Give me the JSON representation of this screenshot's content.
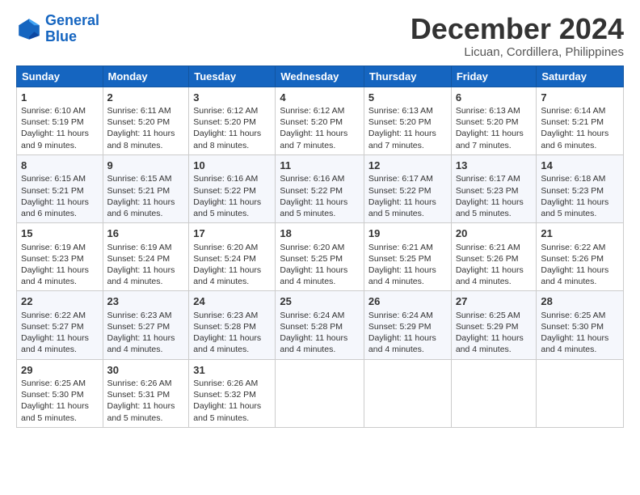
{
  "logo": {
    "line1": "General",
    "line2": "Blue"
  },
  "title": "December 2024",
  "subtitle": "Licuan, Cordillera, Philippines",
  "headers": [
    "Sunday",
    "Monday",
    "Tuesday",
    "Wednesday",
    "Thursday",
    "Friday",
    "Saturday"
  ],
  "weeks": [
    [
      {
        "day": "1",
        "sunrise": "6:10 AM",
        "sunset": "5:19 PM",
        "daylight": "11 hours and 9 minutes."
      },
      {
        "day": "2",
        "sunrise": "6:11 AM",
        "sunset": "5:20 PM",
        "daylight": "11 hours and 8 minutes."
      },
      {
        "day": "3",
        "sunrise": "6:12 AM",
        "sunset": "5:20 PM",
        "daylight": "11 hours and 8 minutes."
      },
      {
        "day": "4",
        "sunrise": "6:12 AM",
        "sunset": "5:20 PM",
        "daylight": "11 hours and 7 minutes."
      },
      {
        "day": "5",
        "sunrise": "6:13 AM",
        "sunset": "5:20 PM",
        "daylight": "11 hours and 7 minutes."
      },
      {
        "day": "6",
        "sunrise": "6:13 AM",
        "sunset": "5:20 PM",
        "daylight": "11 hours and 7 minutes."
      },
      {
        "day": "7",
        "sunrise": "6:14 AM",
        "sunset": "5:21 PM",
        "daylight": "11 hours and 6 minutes."
      }
    ],
    [
      {
        "day": "8",
        "sunrise": "6:15 AM",
        "sunset": "5:21 PM",
        "daylight": "11 hours and 6 minutes."
      },
      {
        "day": "9",
        "sunrise": "6:15 AM",
        "sunset": "5:21 PM",
        "daylight": "11 hours and 6 minutes."
      },
      {
        "day": "10",
        "sunrise": "6:16 AM",
        "sunset": "5:22 PM",
        "daylight": "11 hours and 5 minutes."
      },
      {
        "day": "11",
        "sunrise": "6:16 AM",
        "sunset": "5:22 PM",
        "daylight": "11 hours and 5 minutes."
      },
      {
        "day": "12",
        "sunrise": "6:17 AM",
        "sunset": "5:22 PM",
        "daylight": "11 hours and 5 minutes."
      },
      {
        "day": "13",
        "sunrise": "6:17 AM",
        "sunset": "5:23 PM",
        "daylight": "11 hours and 5 minutes."
      },
      {
        "day": "14",
        "sunrise": "6:18 AM",
        "sunset": "5:23 PM",
        "daylight": "11 hours and 5 minutes."
      }
    ],
    [
      {
        "day": "15",
        "sunrise": "6:19 AM",
        "sunset": "5:23 PM",
        "daylight": "11 hours and 4 minutes."
      },
      {
        "day": "16",
        "sunrise": "6:19 AM",
        "sunset": "5:24 PM",
        "daylight": "11 hours and 4 minutes."
      },
      {
        "day": "17",
        "sunrise": "6:20 AM",
        "sunset": "5:24 PM",
        "daylight": "11 hours and 4 minutes."
      },
      {
        "day": "18",
        "sunrise": "6:20 AM",
        "sunset": "5:25 PM",
        "daylight": "11 hours and 4 minutes."
      },
      {
        "day": "19",
        "sunrise": "6:21 AM",
        "sunset": "5:25 PM",
        "daylight": "11 hours and 4 minutes."
      },
      {
        "day": "20",
        "sunrise": "6:21 AM",
        "sunset": "5:26 PM",
        "daylight": "11 hours and 4 minutes."
      },
      {
        "day": "21",
        "sunrise": "6:22 AM",
        "sunset": "5:26 PM",
        "daylight": "11 hours and 4 minutes."
      }
    ],
    [
      {
        "day": "22",
        "sunrise": "6:22 AM",
        "sunset": "5:27 PM",
        "daylight": "11 hours and 4 minutes."
      },
      {
        "day": "23",
        "sunrise": "6:23 AM",
        "sunset": "5:27 PM",
        "daylight": "11 hours and 4 minutes."
      },
      {
        "day": "24",
        "sunrise": "6:23 AM",
        "sunset": "5:28 PM",
        "daylight": "11 hours and 4 minutes."
      },
      {
        "day": "25",
        "sunrise": "6:24 AM",
        "sunset": "5:28 PM",
        "daylight": "11 hours and 4 minutes."
      },
      {
        "day": "26",
        "sunrise": "6:24 AM",
        "sunset": "5:29 PM",
        "daylight": "11 hours and 4 minutes."
      },
      {
        "day": "27",
        "sunrise": "6:25 AM",
        "sunset": "5:29 PM",
        "daylight": "11 hours and 4 minutes."
      },
      {
        "day": "28",
        "sunrise": "6:25 AM",
        "sunset": "5:30 PM",
        "daylight": "11 hours and 4 minutes."
      }
    ],
    [
      {
        "day": "29",
        "sunrise": "6:25 AM",
        "sunset": "5:30 PM",
        "daylight": "11 hours and 5 minutes."
      },
      {
        "day": "30",
        "sunrise": "6:26 AM",
        "sunset": "5:31 PM",
        "daylight": "11 hours and 5 minutes."
      },
      {
        "day": "31",
        "sunrise": "6:26 AM",
        "sunset": "5:32 PM",
        "daylight": "11 hours and 5 minutes."
      },
      null,
      null,
      null,
      null
    ]
  ]
}
